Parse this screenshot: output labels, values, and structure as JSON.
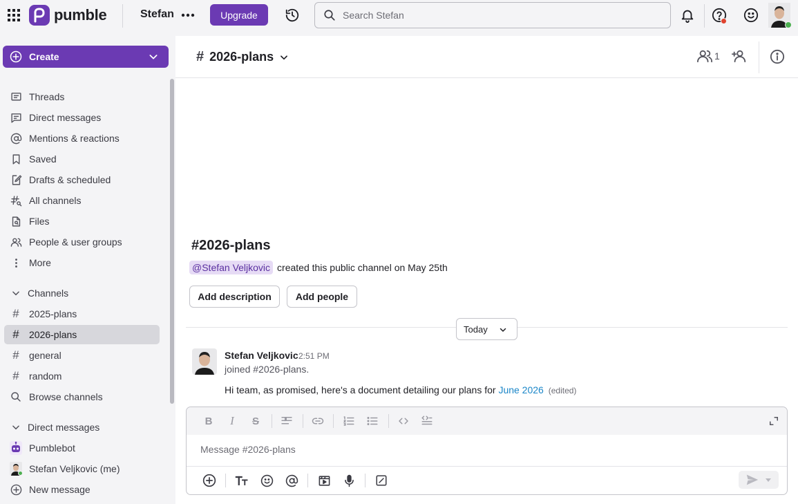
{
  "app": {
    "brand": "pumble",
    "brand_color": "#6b3ab3"
  },
  "topbar": {
    "workspace_name": "Stefan",
    "upgrade_label": "Upgrade",
    "search_placeholder": "Search Stefan",
    "icons": [
      "apps-grid-icon",
      "more-dots-icon",
      "history-icon",
      "search-icon",
      "bell-icon",
      "help-icon",
      "emoji-icon"
    ]
  },
  "sidebar": {
    "create_label": "Create",
    "nav": [
      {
        "label": "Threads",
        "icon": "threads-icon"
      },
      {
        "label": "Direct messages",
        "icon": "direct-messages-icon"
      },
      {
        "label": "Mentions & reactions",
        "icon": "at-icon"
      },
      {
        "label": "Saved",
        "icon": "bookmark-icon"
      },
      {
        "label": "Drafts & scheduled",
        "icon": "draft-icon"
      },
      {
        "label": "All channels",
        "icon": "channels-search-icon"
      },
      {
        "label": "Files",
        "icon": "files-icon"
      },
      {
        "label": "People & user groups",
        "icon": "people-icon"
      },
      {
        "label": "More",
        "icon": "more-vertical-icon"
      }
    ],
    "channels_header": "Channels",
    "channels": [
      {
        "label": "2025-plans",
        "active": false
      },
      {
        "label": "2026-plans",
        "active": true
      },
      {
        "label": "general",
        "active": false
      },
      {
        "label": "random",
        "active": false
      }
    ],
    "browse_channels": "Browse channels",
    "dm_header": "Direct messages",
    "dms": [
      {
        "label": "Pumblebot"
      },
      {
        "label": "Stefan Veljkovic (me)"
      }
    ],
    "new_message": "New message"
  },
  "channel": {
    "name": "2026-plans",
    "member_count": "1",
    "intro_title": "2026-plans",
    "creator_mention": "@Stefan Veljkovic",
    "intro_text": "created this public channel on May 25th",
    "add_description_label": "Add description",
    "add_people_label": "Add people",
    "day_divider": "Today"
  },
  "message": {
    "author": "Stefan Veljkovic",
    "time": "2:51 PM",
    "joined_text": "joined #2026-plans.",
    "body_prefix": "Hi team, as promised, here's a document detailing our plans for",
    "link_text": "June 2026",
    "edited_label": "(edited)"
  },
  "composer": {
    "placeholder": "Message #2026-plans"
  }
}
